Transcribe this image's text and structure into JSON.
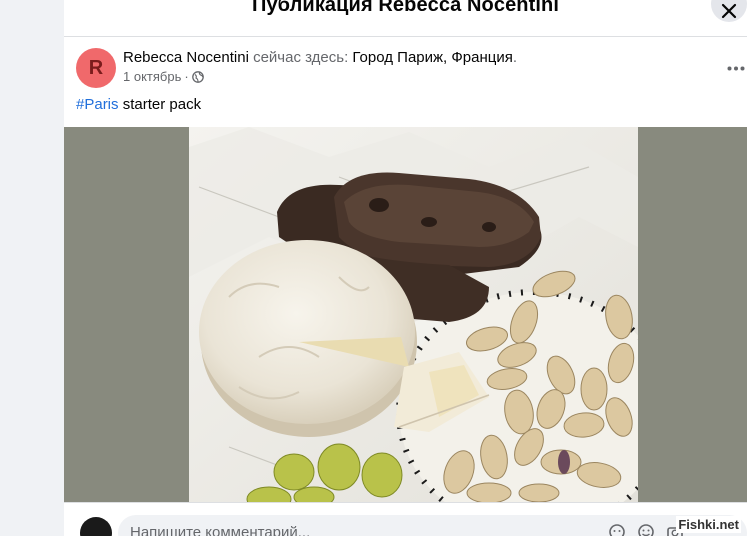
{
  "dialog": {
    "title": "Публикация Rebecca Nocentini"
  },
  "post": {
    "avatar_letter": "R",
    "author": "Rebecca Nocentini",
    "location_prefix": "сейчас здесь:",
    "location": "Город Париж, Франция",
    "location_suffix": ".",
    "date": "1 октябрь",
    "date_separator": "·",
    "privacy_icon": "globe-icon",
    "hashtag": "#Paris",
    "text": "starter pack"
  },
  "comment": {
    "placeholder": "Напишите комментарий..."
  },
  "watermark": "Fishki.net",
  "colors": {
    "avatar_bg": "#f0696b",
    "hashtag": "#216fdb",
    "photo_backdrop": "#888a7e"
  }
}
